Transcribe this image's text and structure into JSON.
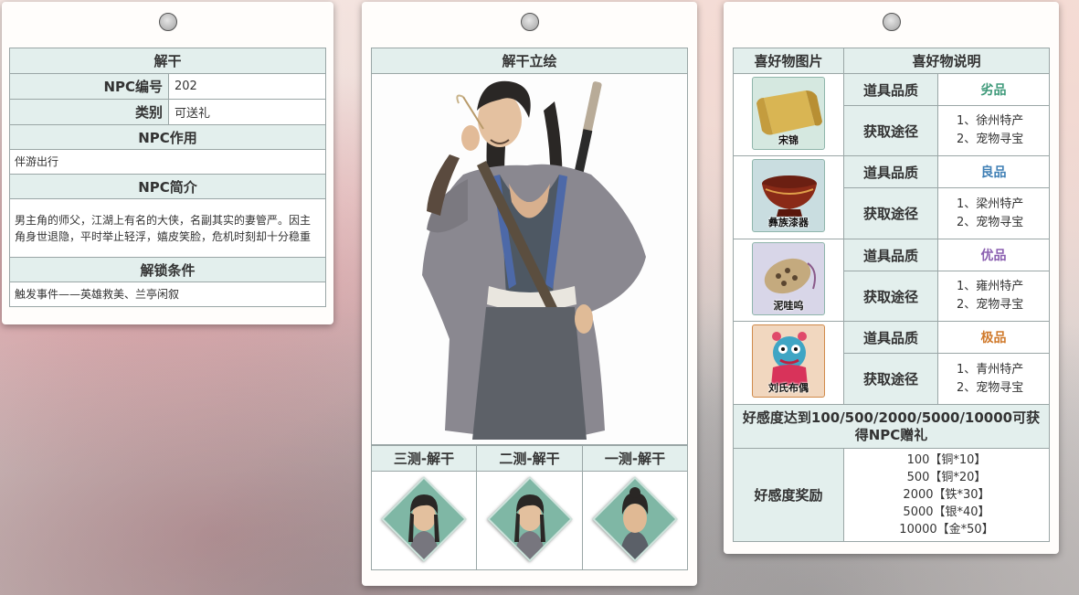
{
  "colors": {
    "header_bg": "#e3efed",
    "border": "#9aa6a6",
    "quality_inferior": "#3f9a7a",
    "quality_good": "#3f7fb5",
    "quality_excellent": "#8a5fb0",
    "quality_legendary": "#d07a2c"
  },
  "npc_info": {
    "name": "解干",
    "id_label": "NPC编号",
    "id_value": "202",
    "type_label": "类别",
    "type_value": "可送礼",
    "role_title": "NPC作用",
    "role_text": "伴游出行",
    "intro_title": "NPC简介",
    "intro_text": "男主角的师父，江湖上有名的大侠，名副其实的妻管严。因主角身世退隐，平时举止轻浮，嬉皮笑脸，危机时刻却十分稳重",
    "unlock_title": "解锁条件",
    "unlock_text": "触发事件——英雄救美、兰亭闲叙"
  },
  "portrait": {
    "title": "解干立绘",
    "variants": [
      {
        "label": "三测-解干",
        "icon": "portrait-thumb"
      },
      {
        "label": "二测-解干",
        "icon": "portrait-thumb"
      },
      {
        "label": "一测-解干",
        "icon": "portrait-thumb"
      }
    ]
  },
  "gifts": {
    "col_image": "喜好物图片",
    "col_desc": "喜好物说明",
    "quality_label": "道具品质",
    "source_label": "获取途径",
    "items": [
      {
        "name": "宋锦",
        "quality": "劣品",
        "source1": "1、徐州特产",
        "source2": "2、宠物寻宝",
        "icon": "silk-scroll-icon"
      },
      {
        "name": "彝族漆器",
        "quality": "良品",
        "source1": "1、梁州特产",
        "source2": "2、宠物寻宝",
        "icon": "lacquer-bowl-icon"
      },
      {
        "name": "泥哇呜",
        "quality": "优品",
        "source1": "1、雍州特产",
        "source2": "2、宠物寻宝",
        "icon": "clay-ocarina-icon"
      },
      {
        "name": "刘氏布偶",
        "quality": "极品",
        "source1": "1、青州特产",
        "source2": "2、宠物寻宝",
        "icon": "cloth-doll-icon"
      }
    ],
    "favor_title": "好感度达到100/500/2000/5000/10000可获得NPC赠礼",
    "reward_label": "好感度奖励",
    "rewards": [
      "100【铜*10】",
      "500【铜*20】",
      "2000【铁*30】",
      "5000【银*40】",
      "10000【金*50】"
    ]
  }
}
